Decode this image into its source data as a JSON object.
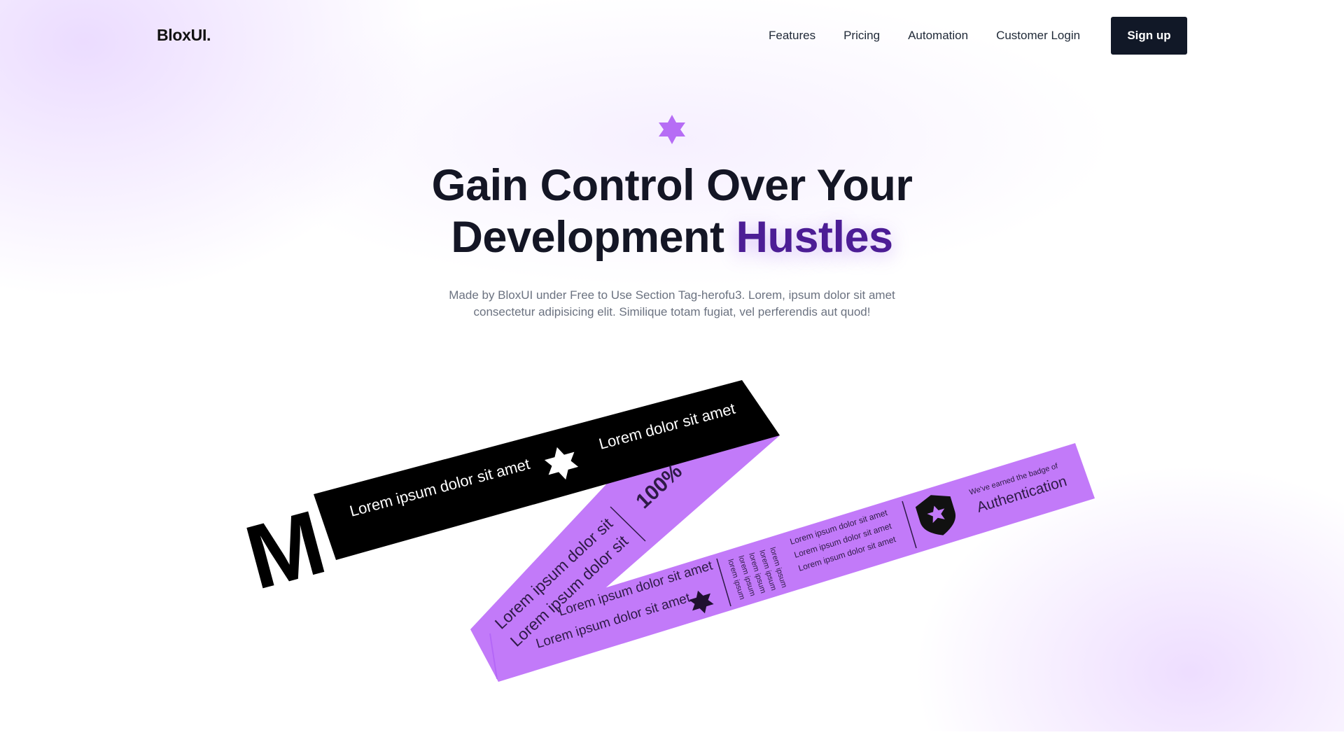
{
  "header": {
    "logo": "BloxUI.",
    "nav": [
      "Features",
      "Pricing",
      "Automation",
      "Customer Login"
    ],
    "signup_label": "Sign up"
  },
  "hero": {
    "title_line1": "Gain Control Over Your",
    "title_line2_plain": "Development ",
    "title_line2_highlight": "Hustles",
    "subtitle_line1": "Made by BloxUI under Free to Use Section Tag-herofu3. Lorem, ipsum dolor sit amet",
    "subtitle_line2": "consectetur adipisicing elit. Similique totam fugiat, vel perferendis aut quod!"
  },
  "ribbons": {
    "black_text_1": "Lorem ipsum dolor sit amet",
    "black_text_2": "Lorem dolor sit amet",
    "big_letter": "M",
    "purple_percent": "100%",
    "purple_diag_1": "Lorem ipsum dolor sit",
    "purple_diag_2": "Lorem ipsum dolor sit",
    "long_text_1": "Lorem ipsum dolor sit amet",
    "long_text_2": "Lorem ipsum dolor sit amet",
    "small_vertical": [
      "lorem ipsum",
      "lorem ipsum",
      "lorem ipsum",
      "lorem ipsum",
      "lorem ipsum"
    ],
    "small_lines": [
      "Lorem ipsum dolor sit amet",
      "Lorem ipsum dolor sit amet",
      "Lorem ipsum dolor sit amet"
    ],
    "badge_caption": "We've earned the badge of",
    "badge_title": "Authentication"
  },
  "colors": {
    "accent_purple": "#c27af9",
    "highlight_text": "#4c1d95",
    "dark": "#111827",
    "star_purple": "#b66df5"
  },
  "icons": [
    "hexagram-star-icon",
    "shield-star-icon"
  ]
}
